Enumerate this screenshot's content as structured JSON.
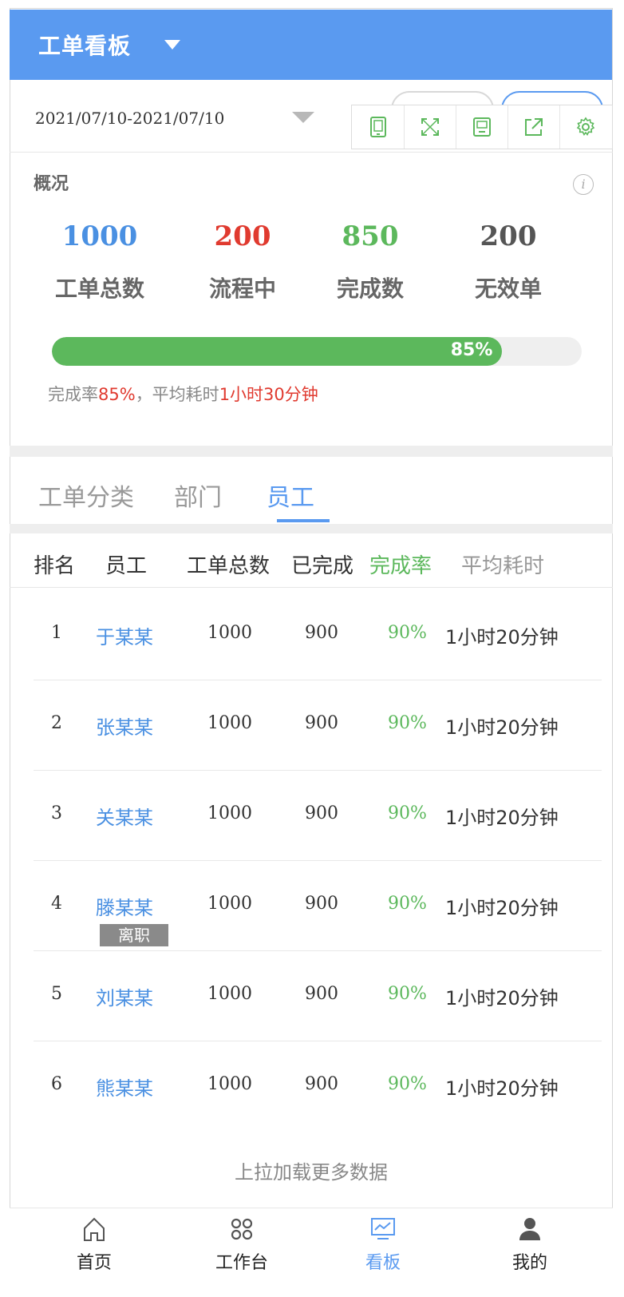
{
  "header": {
    "title": "工单看板"
  },
  "date_range": "2021/07/10-2021/07/10",
  "toolbar": {
    "icons": [
      "tablet-icon",
      "fullscreen-icon",
      "save-icon",
      "share-icon",
      "settings-icon"
    ]
  },
  "overview": {
    "title": "概况",
    "info_label": "i",
    "stats": [
      {
        "value": "1000",
        "label": "工单总数",
        "color": "#4a90e2"
      },
      {
        "value": "200",
        "label": "流程中",
        "color": "#e03a2f"
      },
      {
        "value": "850",
        "label": "完成数",
        "color": "#5cb85c"
      },
      {
        "value": "200",
        "label": "无效单",
        "color": "#555555"
      }
    ],
    "progress": {
      "percent": 85,
      "label": "85%"
    },
    "summary": {
      "prefix": "完成率",
      "rate": "85%",
      "mid": "，平均耗时",
      "time": "1小时30分钟"
    }
  },
  "tabs": [
    {
      "label": "工单分类",
      "active": false
    },
    {
      "label": "部门",
      "active": false
    },
    {
      "label": "员工",
      "active": true
    }
  ],
  "table": {
    "headers": [
      "排名",
      "员工",
      "工单总数",
      "已完成",
      "完成率",
      "平均耗时"
    ],
    "rows": [
      {
        "rank": "1",
        "name": "于某某",
        "total": "1000",
        "done": "900",
        "rate": "90%",
        "avg": "1小时20分钟"
      },
      {
        "rank": "2",
        "name": "张某某",
        "total": "1000",
        "done": "900",
        "rate": "90%",
        "avg": "1小时20分钟"
      },
      {
        "rank": "3",
        "name": "关某某",
        "total": "1000",
        "done": "900",
        "rate": "90%",
        "avg": "1小时20分钟"
      },
      {
        "rank": "4",
        "name": "滕某某",
        "badge": "离职",
        "total": "1000",
        "done": "900",
        "rate": "90%",
        "avg": "1小时20分钟"
      },
      {
        "rank": "5",
        "name": "刘某某",
        "total": "1000",
        "done": "900",
        "rate": "90%",
        "avg": "1小时20分钟"
      },
      {
        "rank": "6",
        "name": "熊某某",
        "total": "1000",
        "done": "900",
        "rate": "90%",
        "avg": "1小时20分钟"
      }
    ],
    "load_more": "上拉加载更多数据"
  },
  "nav": [
    {
      "label": "首页",
      "icon": "home-icon",
      "active": false
    },
    {
      "label": "工作台",
      "icon": "grid-icon",
      "active": false
    },
    {
      "label": "看板",
      "icon": "chart-icon",
      "active": true
    },
    {
      "label": "我的",
      "icon": "user-icon",
      "active": false
    }
  ],
  "colors": {
    "primary": "#5a9af0",
    "success": "#5cb85c",
    "danger": "#e03a2f"
  }
}
